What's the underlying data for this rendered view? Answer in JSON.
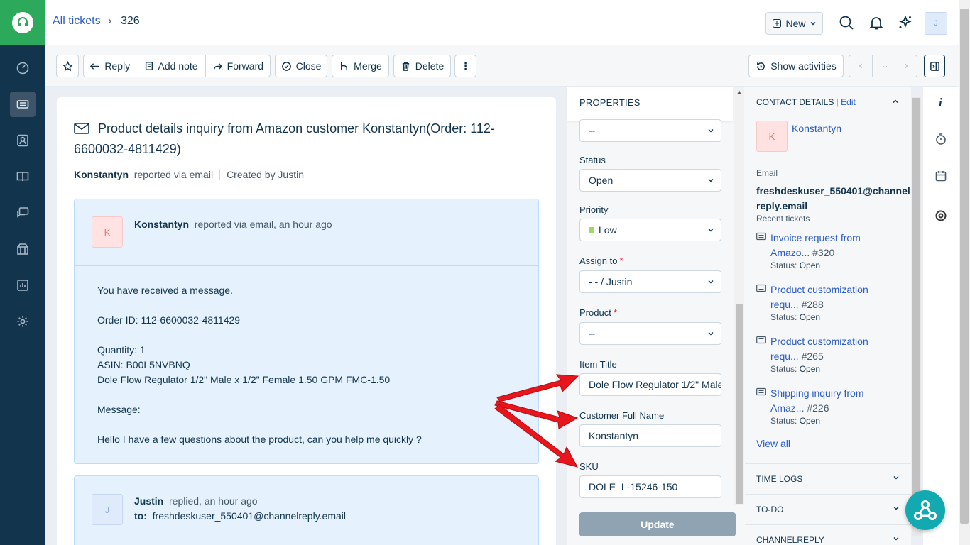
{
  "breadcrumb": {
    "all": "All tickets",
    "id": "326"
  },
  "header": {
    "new_label": "New",
    "avatar_initial": "J"
  },
  "toolbar": {
    "reply": "Reply",
    "add_note": "Add note",
    "forward": "Forward",
    "close": "Close",
    "merge": "Merge",
    "delete": "Delete",
    "show_activities": "Show activities",
    "more": "⋮",
    "pager_mid": "···"
  },
  "ticket": {
    "subject": "Product details inquiry from Amazon customer Konstantyn(Order: 112-6600032-4811429)",
    "reporter": "Konstantyn",
    "reported_via": "reported via email",
    "created_by": "Created by Justin"
  },
  "message1": {
    "avatar": "K",
    "author": "Konstantyn",
    "meta": "reported via email, an hour ago",
    "lines": [
      "You have received a message.",
      "Order ID: 112-6600032-4811429",
      "Quantity: 1",
      "ASIN: B00L5NVBNQ",
      "Dole Flow Regulator 1/2\" Male x 1/2\" Female 1.50 GPM FMC-1.50",
      "Message:",
      "Hello I have a few questions about the product, can you help me quickly ?"
    ]
  },
  "message2": {
    "avatar": "J",
    "author": "Justin",
    "meta": "replied, an hour ago",
    "to_label": "to:",
    "to_value": "freshdeskuser_550401@channelreply.email"
  },
  "properties": {
    "title": "PROPERTIES",
    "top_value": "--",
    "status_label": "Status",
    "status_value": "Open",
    "priority_label": "Priority",
    "priority_value": "Low",
    "assign_label": "Assign to",
    "assign_value": "- - / Justin",
    "product_label": "Product",
    "product_value": "--",
    "item_title_label": "Item Title",
    "item_title_value": "Dole Flow Regulator 1/2\" Male",
    "customer_label": "Customer Full Name",
    "customer_value": "Konstantyn",
    "sku_label": "SKU",
    "sku_value": "DOLE_L-15246-150",
    "required_mark": "*",
    "update_label": "Update"
  },
  "contact": {
    "title": "CONTACT DETAILS",
    "edit": "Edit",
    "sep": "|",
    "avatar": "K",
    "name": "Konstantyn",
    "email_label": "Email",
    "email_line1": "freshdeskuser_550401@channel",
    "email_line2": "reply.email",
    "recent_label": "Recent tickets",
    "status_prefix": "Status:",
    "tickets": [
      {
        "l1": "Invoice request from",
        "l2": "Amazo...",
        "num": "#320",
        "status": "Open"
      },
      {
        "l1": "Product customization",
        "l2": "requ...",
        "num": "#288",
        "status": "Open"
      },
      {
        "l1": "Product customization",
        "l2": "requ...",
        "num": "#265",
        "status": "Open"
      },
      {
        "l1": "Shipping inquiry from",
        "l2": "Amaz...",
        "num": "#226",
        "status": "Open"
      }
    ],
    "view_all": "View all",
    "sections": [
      "TIME LOGS",
      "TO-DO",
      "CHANNELREPLY"
    ]
  },
  "colors": {
    "accent": "#2c5cc5",
    "sidebar": "#12344d",
    "logo": "#2ca95a",
    "arrow": "#e8161c"
  }
}
